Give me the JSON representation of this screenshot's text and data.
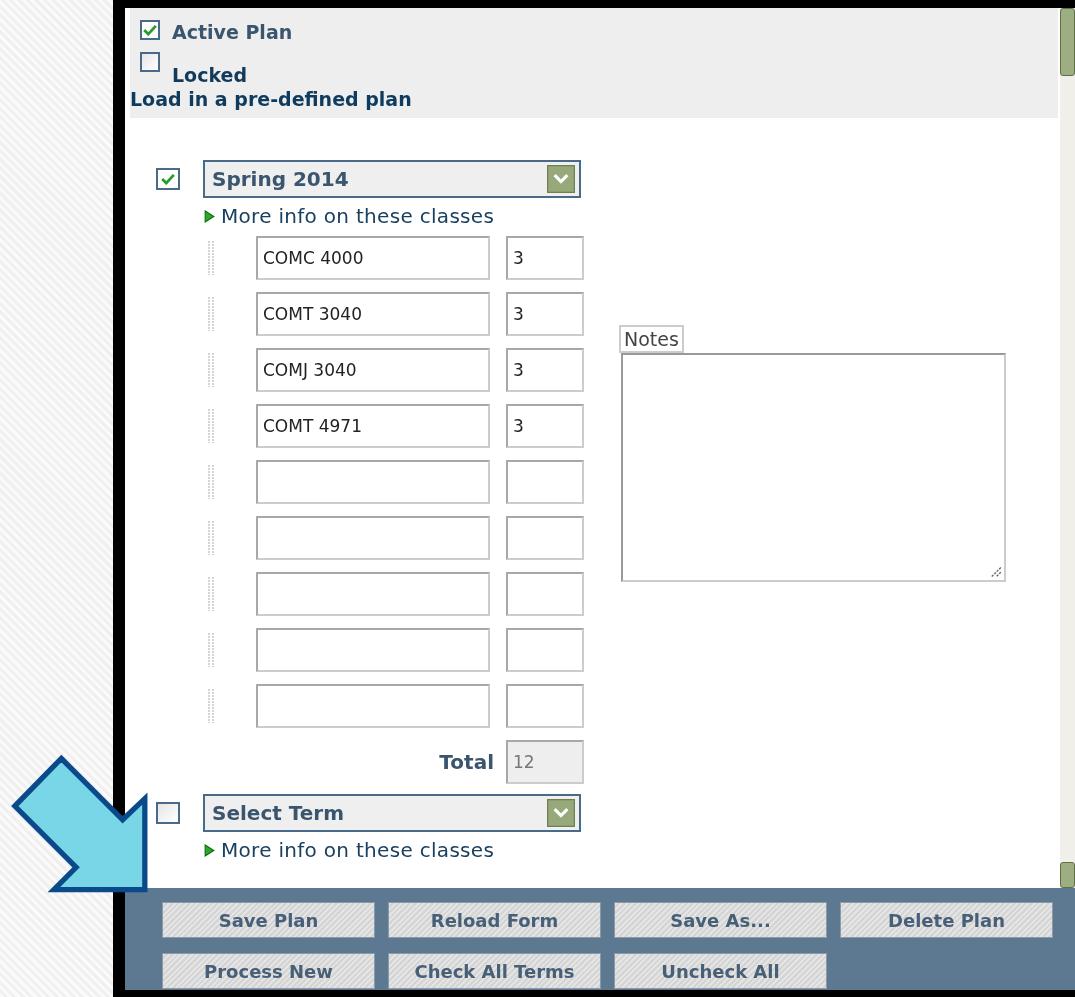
{
  "options": [
    {
      "label": "Active Plan",
      "checked": true
    },
    {
      "label": "Locked",
      "checked": false
    }
  ],
  "load_link": "Load in a pre-defined plan",
  "terms": [
    {
      "checked": true,
      "term": "Spring 2014",
      "more_info": "More info on these classes",
      "classes": [
        {
          "kind": "filled",
          "course": "COMC 4000",
          "credits": "3"
        },
        {
          "kind": "filled",
          "course": "COMT 3040",
          "credits": "3"
        },
        {
          "kind": "filled",
          "course": "COMJ 3040",
          "credits": "3"
        },
        {
          "kind": "filled",
          "course": "COMT 4971",
          "credits": "3"
        },
        {
          "kind": "empty"
        },
        {
          "kind": "empty"
        },
        {
          "kind": "empty"
        },
        {
          "kind": "empty"
        },
        {
          "kind": "empty"
        }
      ],
      "total_label": "Total",
      "total": "12",
      "notes_label": "Notes"
    },
    {
      "checked": false,
      "term": "Select Term",
      "more_info": "More info on these classes"
    }
  ],
  "buttons": [
    "Save Plan",
    "Reload Form",
    "Save As...",
    "Delete Plan",
    "Process New",
    "Check All Terms",
    "Uncheck All"
  ]
}
